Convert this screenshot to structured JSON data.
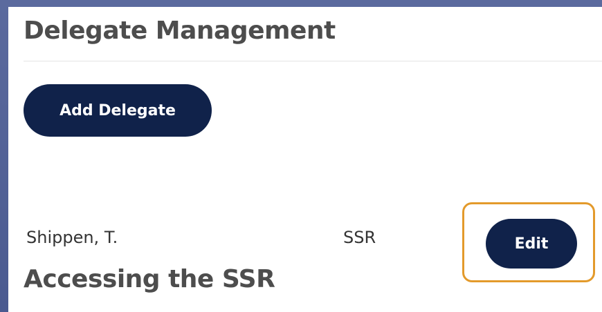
{
  "page": {
    "title": "Delegate Management",
    "section_heading": "Accessing the SSR"
  },
  "toolbar": {
    "add_label": "Add Delegate"
  },
  "delegates": [
    {
      "name": "Shippen, T.",
      "type": "SSR",
      "edit_label": "Edit"
    }
  ],
  "colors": {
    "button_bg": "#10224a",
    "button_text": "#ffffff",
    "highlight_border": "#e39a2b",
    "heading_text": "#4d4d4d",
    "body_text": "#333333",
    "frame_bg": "#5b6a9e"
  }
}
